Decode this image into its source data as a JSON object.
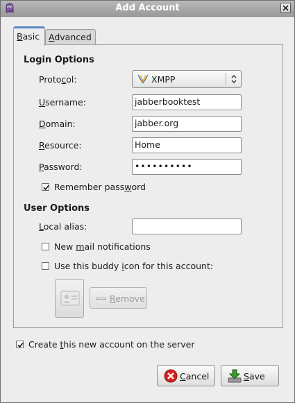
{
  "window": {
    "title": "Add Account"
  },
  "tabs": [
    {
      "label": "Basic",
      "mnemonic": "B",
      "rest": "asic",
      "active": true
    },
    {
      "label": "Advanced",
      "mnemonic": "A",
      "rest": "dvanced",
      "active": false
    }
  ],
  "login_options": {
    "heading": "Login Options",
    "protocol": {
      "label_pre": "Proto",
      "label_m": "c",
      "label_post": "ol:",
      "value": "XMPP",
      "icon": "xmpp-bulb-icon"
    },
    "username": {
      "label_m": "U",
      "label_post": "sername:",
      "value": "jabberbooktest"
    },
    "domain": {
      "label_m": "D",
      "label_post": "omain:",
      "value": "jabber.org"
    },
    "resource": {
      "label_m": "R",
      "label_post": "esource:",
      "value": "Home"
    },
    "password": {
      "label_m": "P",
      "label_post": "assword:",
      "value": "••••••••••"
    },
    "remember": {
      "label_pre": "Remember pass",
      "label_m": "w",
      "label_post": "ord",
      "checked": true
    }
  },
  "user_options": {
    "heading": "User Options",
    "local_alias": {
      "label_m": "L",
      "label_post": "ocal alias:",
      "value": ""
    },
    "new_mail": {
      "label_pre": "New ",
      "label_m": "m",
      "label_post": "ail notifications",
      "checked": false
    },
    "buddy_icon": {
      "label_pre": "Use this buddy ",
      "label_m": "i",
      "label_post": "con for this account:",
      "checked": false
    },
    "remove_button": {
      "label_m": "R",
      "label_post": "emove"
    }
  },
  "create_account": {
    "label_pre": "Create ",
    "label_m": "t",
    "label_post": "his new account on the server",
    "checked": true
  },
  "buttons": {
    "cancel": {
      "label_m": "C",
      "label_post": "ancel",
      "icon": "cancel-icon",
      "color": "#d42020"
    },
    "save": {
      "label_m": "S",
      "label_post": "ave",
      "icon": "save-icon",
      "color": "#3b9a2e"
    }
  },
  "colors": {
    "tab_accent": "#5a86c5",
    "titlebar": "#a8a8a8"
  }
}
